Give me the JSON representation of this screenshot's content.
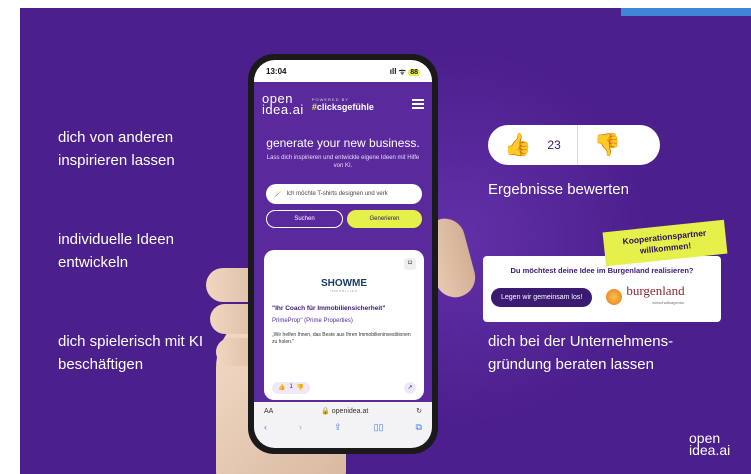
{
  "features_left": [
    "dich von anderen inspirieren lassen",
    "individuelle Ideen entwickeln",
    "dich spielerisch mit KI beschäftigen"
  ],
  "features_right": {
    "rate": "Ergebnisse bewerten",
    "consult": "dich bei der Unternehmens-gründung beraten lassen"
  },
  "phone": {
    "time": "13:04",
    "signal": "ıll ᯤ",
    "battery": "88",
    "logo_line1": "open",
    "logo_line2": "idea.ai",
    "powered_by": "POWERED BY",
    "brand_hash": "#",
    "brand_name": "clicksgefühle",
    "headline": "generate your new business.",
    "sub": "Lass dich inspirieren und entwickle eigene Ideen mit Hilfe von KI.",
    "prompt": "Ich möchte T-shirts designen und verk",
    "btn_search": "Suchen",
    "btn_generate": "Generieren",
    "card": {
      "logo": "SHOWME",
      "logo_sub": "IMMOBILIEN",
      "title": "\"Ihr Coach für Immobiliensicherheit\"",
      "company": "PrimeProp\" (Prime Properties)",
      "text": "„Wir helfen Ihnen, das Beste aus Ihren Immobilieninvestitionen zu holen.\"",
      "votes": "1"
    },
    "browser": {
      "aa": "AA",
      "url": "openidea.at"
    }
  },
  "vote": {
    "count": "23"
  },
  "badge": "Kooperationspartner willkommen!",
  "burgenland": {
    "question": "Du möchtest deine Idee im Burgenland realisieren?",
    "button": "Legen wir gemeinsam los!",
    "name": "burgenland",
    "tagline": "wirtschaftsagentur"
  },
  "corner_logo": {
    "line1": "open",
    "line2": "idea.ai"
  },
  "colors": {
    "bg": "#4b1f8c",
    "accent": "#e6f04a",
    "primary": "#3b1a72"
  }
}
